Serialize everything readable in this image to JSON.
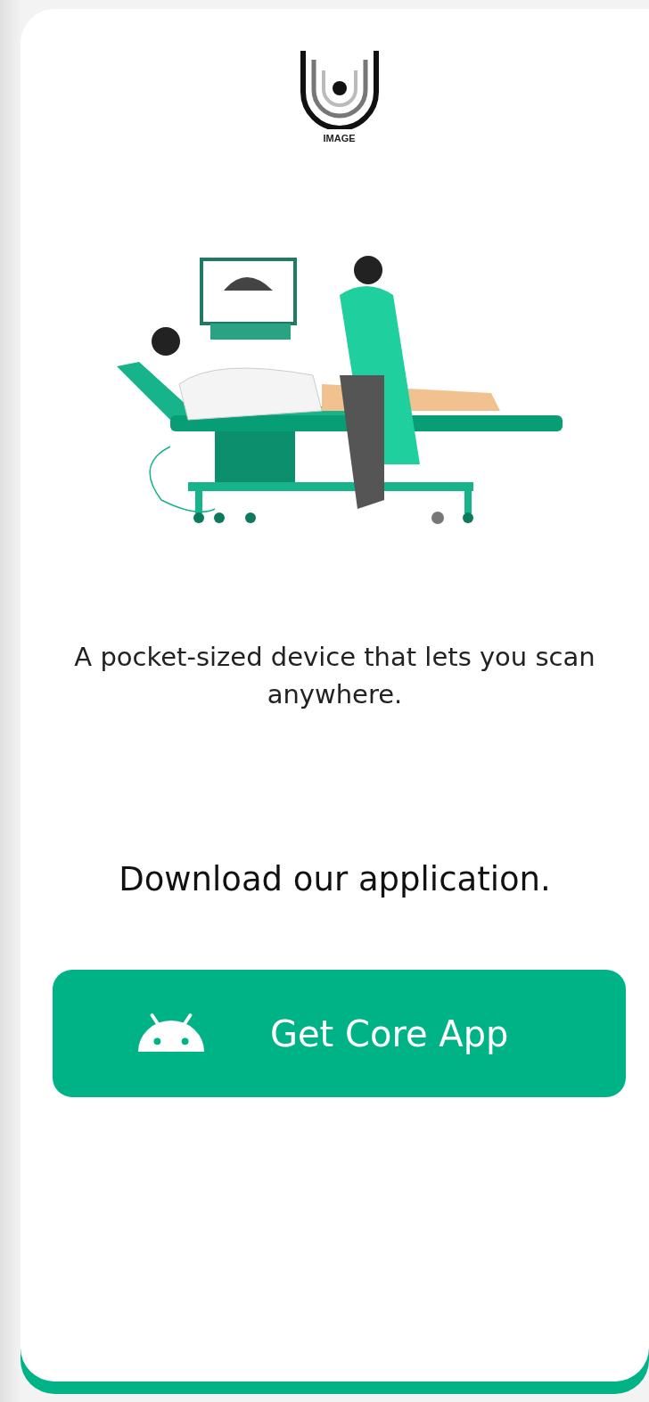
{
  "logo": {
    "text": "IMAGE"
  },
  "tagline": "A pocket-sized device that lets you scan anywhere.",
  "download_prompt": "Download our application.",
  "download_button": {
    "label": "Get Core App"
  }
}
